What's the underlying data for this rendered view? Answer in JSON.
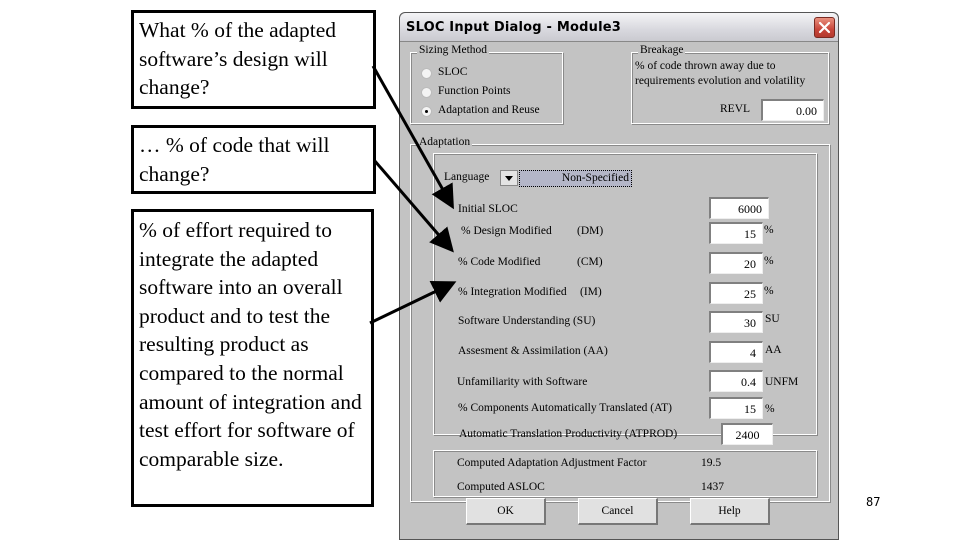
{
  "callouts": [
    {
      "text": "What % of the adapted software’s design will change?"
    },
    {
      "text": "… % of code that will change?"
    },
    {
      "text": "% of effort required to integrate the adapted software into an overall product and to test the resulting product as compared to the normal amount of integration and test effort for software of comparable size."
    }
  ],
  "slide_number": "87",
  "dialog": {
    "title": "SLOC Input Dialog - Module3",
    "close_icon": "close-icon",
    "sizing_method": {
      "legend": "Sizing Method",
      "options": [
        {
          "label": "SLOC",
          "checked": false
        },
        {
          "label": "Function Points",
          "checked": false
        },
        {
          "label": "Adaptation and Reuse",
          "checked": true
        }
      ]
    },
    "breakage": {
      "legend": "Breakage",
      "description_line1": "% of code thrown away due to",
      "description_line2": "requirements evolution and volatility",
      "revl_label": "REVL",
      "revl_value": "0.00"
    },
    "adaptation": {
      "legend": "Adaptation",
      "language_label": "Language",
      "language_value": "Non-Specified",
      "rows": [
        {
          "label": "Initial SLOC",
          "abbr": "",
          "value": "6000",
          "unit": ""
        },
        {
          "label": "% Design Modified",
          "abbr": "(DM)",
          "value": "15",
          "unit": "%"
        },
        {
          "label": "% Code Modified",
          "abbr": "(CM)",
          "value": "20",
          "unit": "%"
        },
        {
          "label": "% Integration Modified",
          "abbr": "(IM)",
          "value": "25",
          "unit": "%"
        },
        {
          "label": "Software Understanding (SU)",
          "abbr": "",
          "value": "30",
          "unit": "SU"
        },
        {
          "label": "Assesment & Assimilation (AA)",
          "abbr": "",
          "value": "4",
          "unit": "AA"
        },
        {
          "label": "Unfamiliarity with Software",
          "abbr": "",
          "value": "0.4",
          "unit": "UNFM"
        },
        {
          "label": "% Components Automatically Translated (AT)",
          "abbr": "",
          "value": "15",
          "unit": "%"
        },
        {
          "label": "Automatic Translation Productivity (ATPROD)",
          "abbr": "",
          "value": "2400",
          "unit": ""
        }
      ]
    },
    "computed": {
      "aaf_label": "Computed Adaptation Adjustment Factor",
      "aaf_value": "19.5",
      "asloc_label": "Computed ASLOC",
      "asloc_value": "1437"
    },
    "buttons": {
      "ok": "OK",
      "cancel": "Cancel",
      "help": "Help"
    }
  }
}
